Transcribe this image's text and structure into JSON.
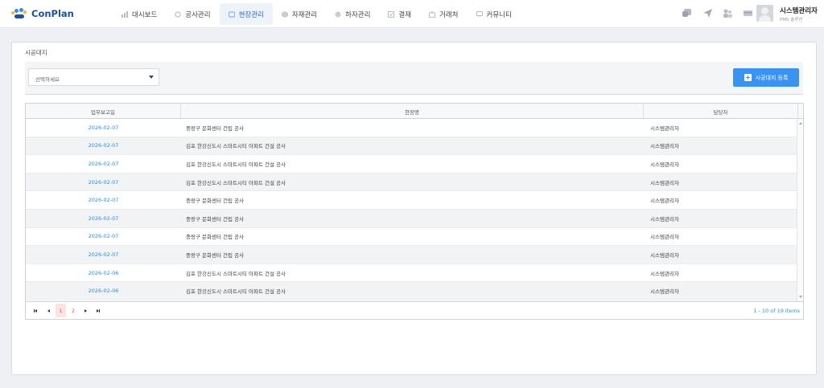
{
  "app": {
    "brand": "ConPlan"
  },
  "nav": [
    {
      "label": "대시보드",
      "icon": "dashboard-icon"
    },
    {
      "label": "공사관리",
      "icon": "construction-icon"
    },
    {
      "label": "현장관리",
      "icon": "site-icon",
      "active": true
    },
    {
      "label": "자재관리",
      "icon": "material-icon"
    },
    {
      "label": "하자관리",
      "icon": "defect-icon"
    },
    {
      "label": "결재",
      "icon": "approval-icon"
    },
    {
      "label": "거래처",
      "icon": "vendor-icon"
    },
    {
      "label": "커뮤니티",
      "icon": "community-icon"
    }
  ],
  "user": {
    "name": "시스템관리자",
    "sub": "PMS 솔루션"
  },
  "page": {
    "title": "시공대지",
    "select_placeholder": "선택하세요",
    "register_label": "시공대지 등록"
  },
  "grid": {
    "columns": [
      "업무보고일",
      "현장명",
      "담당자"
    ],
    "rows": [
      {
        "date": "2026-02-07",
        "site": "중랑구 문화센터 건립 공사",
        "manager": "시스템관리자"
      },
      {
        "date": "2026-02-07",
        "site": "김포 한강신도시 스마트시티 아파트 건설 공사",
        "manager": "시스템관리자"
      },
      {
        "date": "2026-02-07",
        "site": "김포 한강신도시 스마트시티 아파트 건설 공사",
        "manager": "시스템관리자"
      },
      {
        "date": "2026-02-07",
        "site": "김포 한강신도시 스마트시티 아파트 건설 공사",
        "manager": "시스템관리자"
      },
      {
        "date": "2026-02-07",
        "site": "중랑구 문화센터 건립 공사",
        "manager": "시스템관리자"
      },
      {
        "date": "2026-02-07",
        "site": "중랑구 문화센터 건립 공사",
        "manager": "시스템관리자"
      },
      {
        "date": "2026-02-07",
        "site": "중랑구 문화센터 건립 공사",
        "manager": "시스템관리자"
      },
      {
        "date": "2026-02-07",
        "site": "중랑구 문화센터 건립 공사",
        "manager": "시스템관리자"
      },
      {
        "date": "2026-02-06",
        "site": "김포 한강신도시 스마트시티 아파트 건설 공사",
        "manager": "시스템관리자"
      },
      {
        "date": "2026-02-06",
        "site": "김포 한강신도시 스마트시티 아파트 건설 공사",
        "manager": "시스템관리자"
      }
    ]
  },
  "pager": {
    "pages": [
      "1",
      "2"
    ],
    "current": "1",
    "info": "1 - 10 of 19 items"
  },
  "colors": {
    "accent": "#2c67c9",
    "link": "#2a8ee6",
    "button": "#3a93f0",
    "pager_active": "#e05a5a"
  }
}
